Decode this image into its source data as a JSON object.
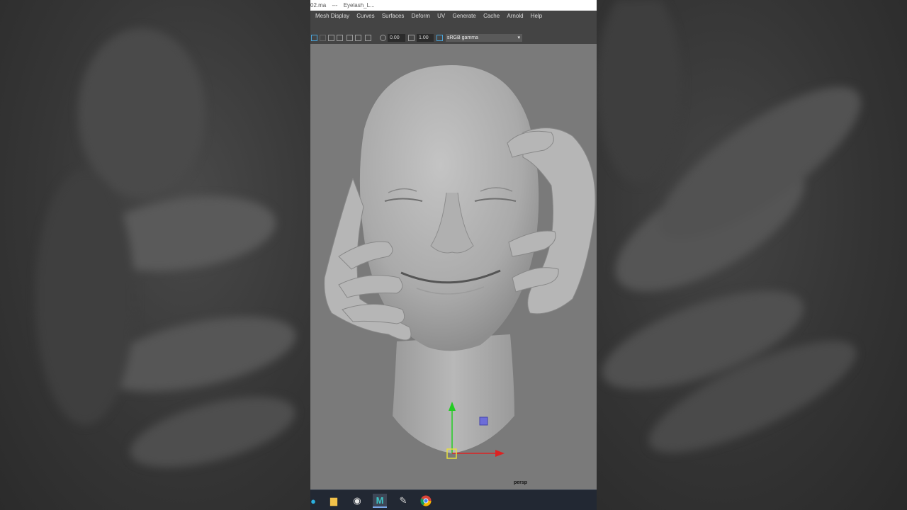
{
  "window": {
    "title_file": "02.ma",
    "title_sep": "---",
    "title_scene": "Eyelash_L..."
  },
  "menu": [
    {
      "label": "Mesh Display"
    },
    {
      "label": "Curves"
    },
    {
      "label": "Surfaces"
    },
    {
      "label": "Deform"
    },
    {
      "label": "UV"
    },
    {
      "label": "Generate"
    },
    {
      "label": "Cache"
    },
    {
      "label": "Arnold"
    },
    {
      "label": "Help"
    }
  ],
  "toolbar": {
    "exposure": "0.00",
    "gamma": "1.00",
    "color_space": "sRGB gamma"
  },
  "viewport": {
    "camera_label": "persp",
    "colors": {
      "background": "#7a7a7a",
      "mesh": "#b4b4b4",
      "manip_y": "#22cc22",
      "manip_x": "#dd2222",
      "manip_z": "#6d6dd8",
      "manip_center": "#e8e040"
    }
  },
  "taskbar": {
    "icons": [
      "edge-icon",
      "file-explorer-icon",
      "obs-icon",
      "maya-icon",
      "paint-icon",
      "chrome-icon"
    ]
  }
}
